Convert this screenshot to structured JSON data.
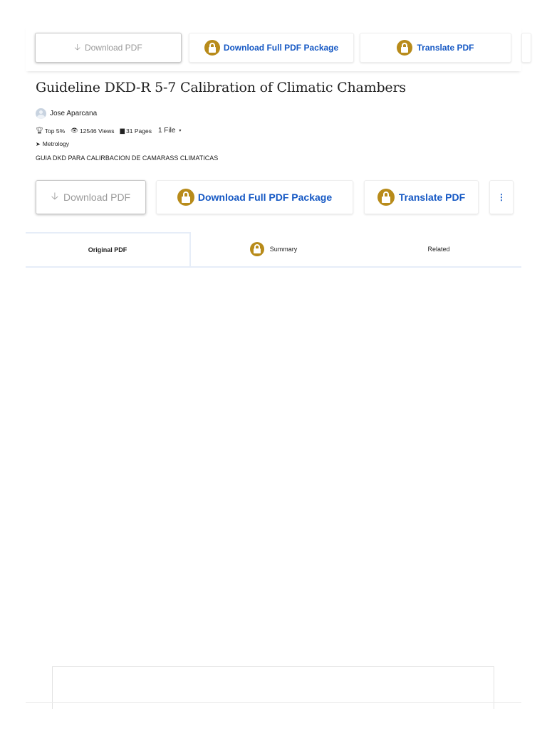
{
  "top_toolbar": {
    "download_pdf": "Download PDF",
    "download_full_package": "Download Full PDF Package",
    "translate_pdf": "Translate PDF"
  },
  "document": {
    "title": "Guideline DKD-R 5-7 Calibration of Climatic Chambers",
    "author": "Jose Aparcana",
    "stats": {
      "rank": "Top 5%",
      "views": "12546 Views",
      "pages": "31 Pages",
      "files": "1 File"
    },
    "tag": "Metrology",
    "description": "GUIA DKD PARA CALIRBACION DE CAMARASS CLIMATICAS"
  },
  "main_toolbar": {
    "download_pdf": "Download PDF",
    "download_full_package": "Download Full PDF Package",
    "translate_pdf": "Translate PDF",
    "more": "⋮"
  },
  "tabs": [
    {
      "label": "Original PDF",
      "active": true
    },
    {
      "label": "Summary",
      "locked": true
    },
    {
      "label": "Related"
    }
  ],
  "colors": {
    "accent_blue": "#1558c4",
    "lock_gold": "#b88b1a",
    "tab_border": "#e6edf8"
  },
  "icons": {
    "download": "down-arrow-icon",
    "lock": "lock-icon",
    "trophy": "trophy-icon",
    "eye": "eye-icon",
    "file": "file-icon",
    "tag": "tag-icon",
    "more": "vertical-ellipsis-icon"
  }
}
